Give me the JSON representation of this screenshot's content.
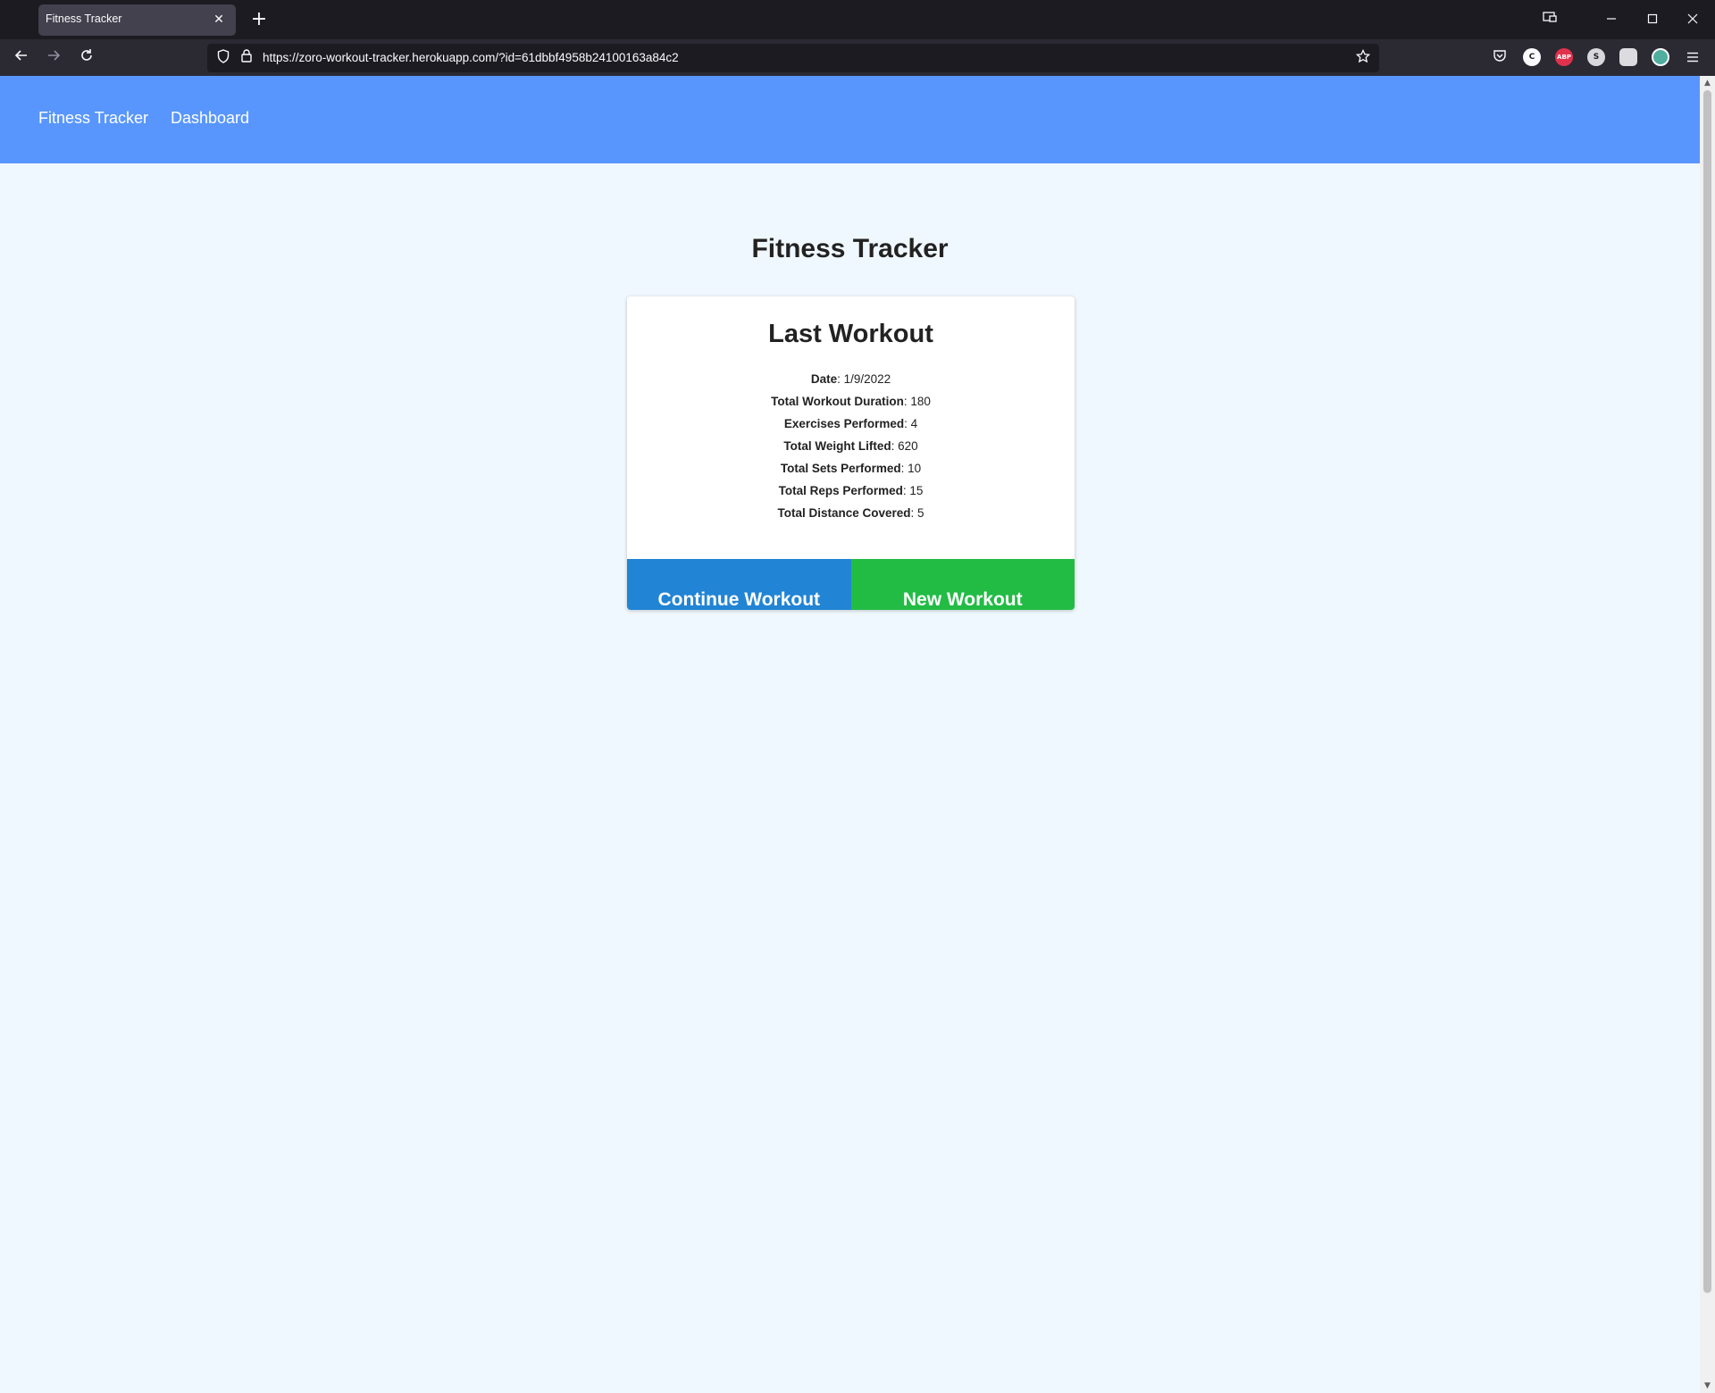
{
  "browser": {
    "tab_title": "Fitness Tracker",
    "url": "https://zoro-workout-tracker.herokuapp.com/?id=61dbbf4958b24100163a84c2",
    "extensions": [
      {
        "name": "pocket-icon",
        "label": ""
      },
      {
        "name": "extension-c-icon",
        "label": "C"
      },
      {
        "name": "adblock-icon",
        "label": "ABP"
      },
      {
        "name": "extension-s-icon",
        "label": "S"
      },
      {
        "name": "extension-ghost-icon",
        "label": ""
      },
      {
        "name": "extension-mountain-icon",
        "label": ""
      }
    ]
  },
  "site_nav": {
    "brand": "Fitness Tracker",
    "dashboard": "Dashboard"
  },
  "page": {
    "title": "Fitness Tracker"
  },
  "last_workout": {
    "title": "Last Workout",
    "stats": [
      {
        "label": "Date",
        "value": "1/9/2022"
      },
      {
        "label": "Total Workout Duration",
        "value": "180"
      },
      {
        "label": "Exercises Performed",
        "value": "4"
      },
      {
        "label": "Total Weight Lifted",
        "value": "620"
      },
      {
        "label": "Total Sets Performed",
        "value": "10"
      },
      {
        "label": "Total Reps Performed",
        "value": "15"
      },
      {
        "label": "Total Distance Covered",
        "value": "5"
      }
    ],
    "continue_label": "Continue Workout",
    "new_label": "New Workout"
  },
  "colors": {
    "nav_blue": "#5896fe",
    "page_bg": "#f0f8ff",
    "continue_blue": "#2184d4",
    "new_green": "#22bc45"
  }
}
